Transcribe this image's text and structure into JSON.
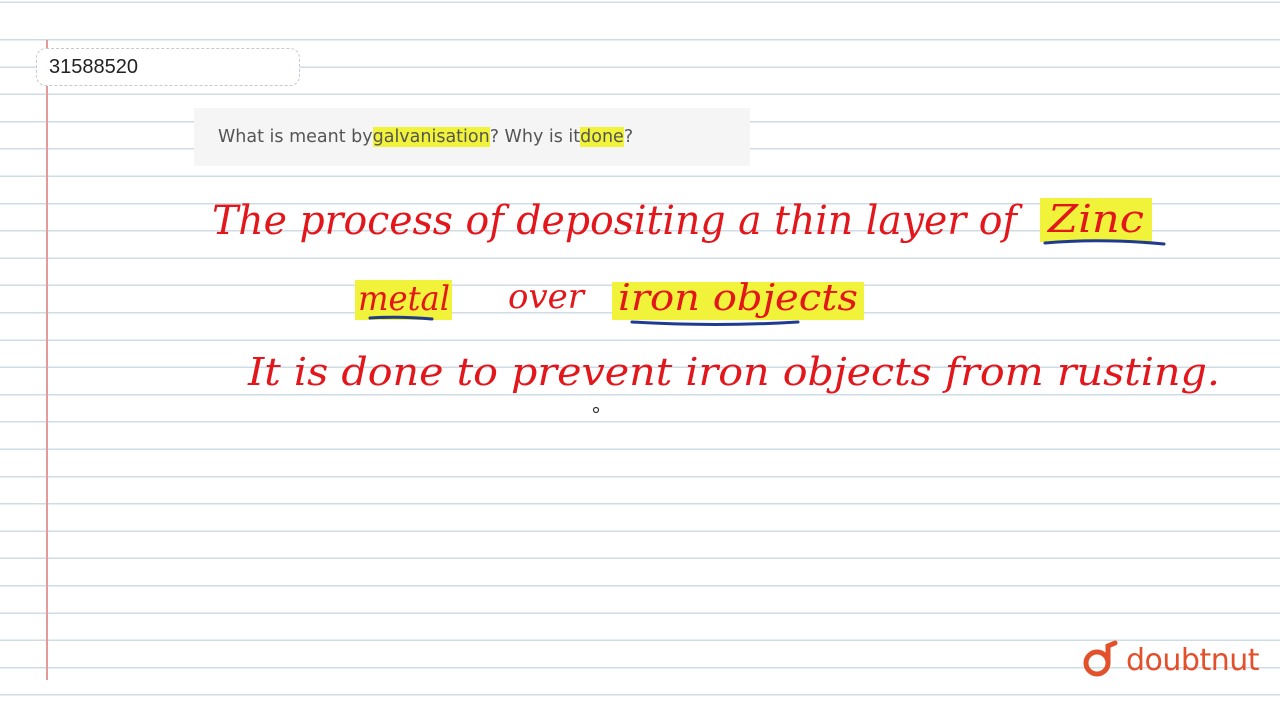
{
  "id_label": "31588520",
  "question": {
    "part1": "What is meant by ",
    "highlight1": "galvanisation",
    "part2": "? Why is it ",
    "highlight2": "done",
    "part3": "?"
  },
  "answer": {
    "line1_text": "The process of depositing a thin layer of",
    "line1_keyword": "Zinc",
    "line2_keyword1": "metal",
    "line2_text": "over",
    "line2_keyword2": "iron objects",
    "line3_text": "It is done to prevent iron objects from rusting."
  },
  "branding": {
    "logo_text": "doubtnut",
    "logo_icon": "doubtnut-d-icon"
  },
  "colors": {
    "ink_red": "#e2161b",
    "ink_blue": "#1f3b8f",
    "highlight_yellow": "#f1f23a",
    "rule_blue": "#cfdce6",
    "margin_red": "#e59a9a",
    "brand_orange": "#e3502c"
  }
}
